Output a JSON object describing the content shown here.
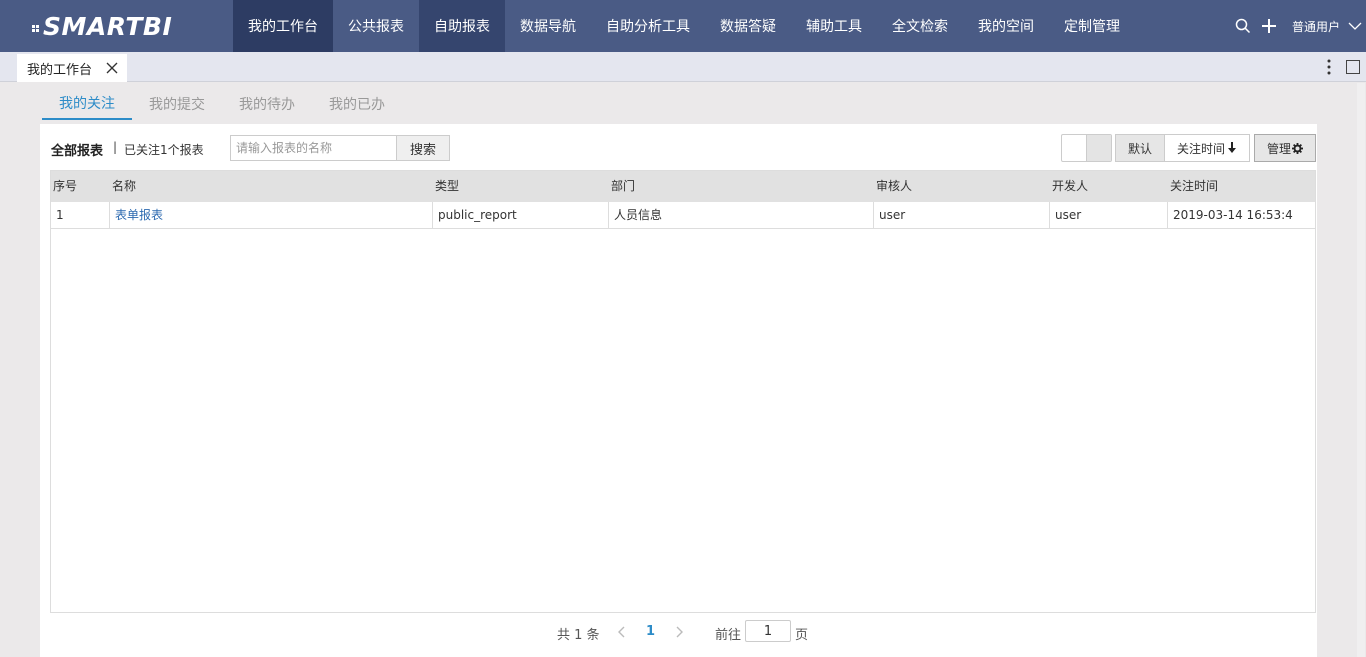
{
  "app": {
    "logo_text": "SMARTBI"
  },
  "nav": {
    "items": [
      {
        "label": "我的工作台"
      },
      {
        "label": "公共报表"
      },
      {
        "label": "自助报表"
      },
      {
        "label": "数据导航"
      },
      {
        "label": "自助分析工具"
      },
      {
        "label": "数据答疑"
      },
      {
        "label": "辅助工具"
      },
      {
        "label": "全文检索"
      },
      {
        "label": "我的空间"
      },
      {
        "label": "定制管理"
      }
    ],
    "user_name": "普通用户"
  },
  "open_tab": {
    "label": "我的工作台"
  },
  "subtabs": [
    {
      "label": "我的关注"
    },
    {
      "label": "我的提交"
    },
    {
      "label": "我的待办"
    },
    {
      "label": "我的已办"
    }
  ],
  "toolbar": {
    "title": "全部报表",
    "separator": "|",
    "count_text": "已关注1个报表",
    "search_placeholder": "请输入报表的名称",
    "search_label": "搜索",
    "sort_default_label": "默认",
    "sort_time_label": "关注时间",
    "manage_label": "管理"
  },
  "table": {
    "columns": [
      "序号",
      "名称",
      "类型",
      "部门",
      "审核人",
      "开发人",
      "关注时间"
    ],
    "rows": [
      [
        "1",
        "表单报表",
        "public_report",
        "人员信息",
        "user",
        "user",
        "2019-03-14 16:53:4"
      ]
    ]
  },
  "pager": {
    "total_text": "共 1 条",
    "current_page": "1",
    "goto_label": "前往",
    "goto_value": "1",
    "page_suffix": "页"
  },
  "colors": {
    "nav_bg": "#4a5b85",
    "nav_active": "#2d3c63",
    "accent": "#2d8cc8",
    "link": "#2d6ab0"
  }
}
